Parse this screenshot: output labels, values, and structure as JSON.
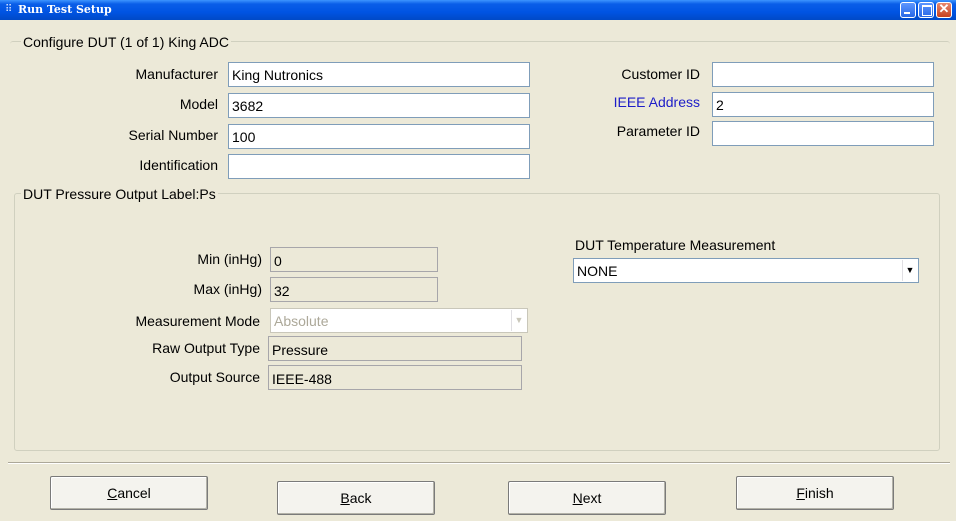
{
  "window": {
    "title": "Run Test Setup"
  },
  "dut_group": {
    "legend": "Configure DUT (1 of 1) King ADC",
    "manufacturer_label": "Manufacturer",
    "manufacturer_value": "King Nutronics",
    "model_label": "Model",
    "model_value": "3682",
    "serial_label": "Serial Number",
    "serial_value": "100",
    "identification_label": "Identification",
    "identification_value": "",
    "customer_id_label": "Customer ID",
    "customer_id_value": "",
    "ieee_label": "IEEE Address",
    "ieee_value": "2",
    "parameter_id_label": "Parameter ID",
    "parameter_id_value": ""
  },
  "pressure_group": {
    "legend": "DUT Pressure  Output Label:Ps",
    "min_label": "Min (inHg)",
    "min_value": "0",
    "max_label": "Max (inHg)",
    "max_value": "32",
    "mode_label": "Measurement Mode",
    "mode_value": "Absolute",
    "raw_output_label": "Raw Output Type",
    "raw_output_value": "Pressure",
    "output_source_label": "Output Source",
    "output_source_value": "IEEE-488",
    "temp_label": "DUT Temperature Measurement",
    "temp_value": "NONE"
  },
  "buttons": {
    "cancel": {
      "mnemonic": "C",
      "rest": "ancel"
    },
    "back": {
      "mnemonic": "B",
      "rest": "ack"
    },
    "next": {
      "mnemonic": "N",
      "rest": "ext"
    },
    "finish": {
      "mnemonic": "F",
      "rest": "inish"
    }
  },
  "colors": {
    "titlebar": "#0054e3",
    "window_bg": "#ece9d8",
    "ieee_label": "#1d1dc8"
  }
}
